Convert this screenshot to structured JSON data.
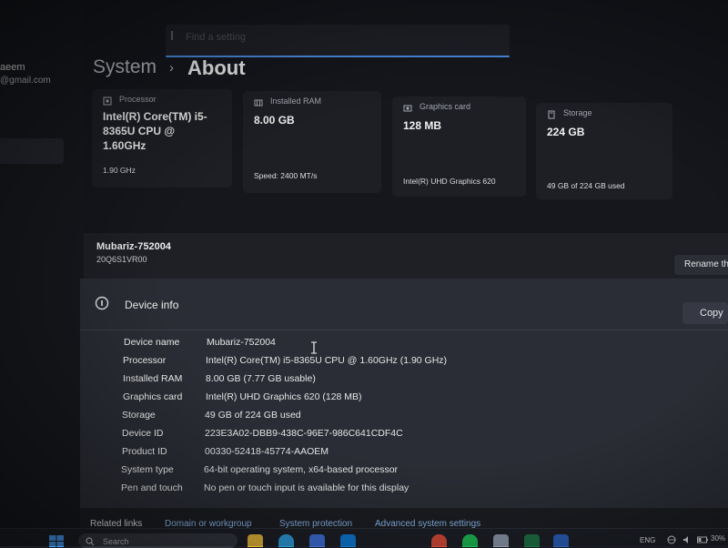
{
  "sidebar": {
    "user_name": "aeem",
    "user_email": "@gmail.com"
  },
  "search": {
    "placeholder": "Find a setting"
  },
  "breadcrumb": {
    "parent": "System",
    "separator": "›",
    "current": "About"
  },
  "specs_cards": [
    {
      "icon": "processor-icon",
      "title": "Processor",
      "value": "Intel(R) Core(TM) i5-8365U CPU @ 1.60GHz",
      "sub": "1.90 GHz"
    },
    {
      "icon": "ram-icon",
      "title": "Installed RAM",
      "value": "8.00 GB",
      "sub": "Speed: 2400 MT/s"
    },
    {
      "icon": "graphics-card-icon",
      "title": "Graphics card",
      "value": "128 MB",
      "sub": "Intel(R) UHD Graphics 620"
    },
    {
      "icon": "storage-icon",
      "title": "Storage",
      "value": "224 GB",
      "sub": "49 GB of 224 GB used"
    }
  ],
  "device": {
    "name": "Mubariz-752004",
    "model": "20Q6S1VR00",
    "rename_label": "Rename this PC"
  },
  "device_info": {
    "title": "Device info",
    "copy_label": "Copy",
    "rows": [
      {
        "label": "Device name",
        "value": "Mubariz-752004"
      },
      {
        "label": "Processor",
        "value": "Intel(R) Core(TM) i5-8365U CPU @ 1.60GHz (1.90 GHz)"
      },
      {
        "label": "Installed RAM",
        "value": "8.00 GB (7.77 GB usable)"
      },
      {
        "label": "Graphics card",
        "value": "Intel(R) UHD Graphics 620 (128 MB)"
      },
      {
        "label": "Storage",
        "value": "49 GB of 224 GB used"
      },
      {
        "label": "Device ID",
        "value": "223E3A02-DBB9-438C-96E7-986C641CDF4C"
      },
      {
        "label": "Product ID",
        "value": "00330-52418-45774-AAOEM"
      },
      {
        "label": "System type",
        "value": "64-bit operating system, x64-based processor"
      },
      {
        "label": "Pen and touch",
        "value": "No pen or touch input is available for this display"
      }
    ]
  },
  "related_links": {
    "label": "Related links",
    "links": [
      "Domain or workgroup",
      "System protection",
      "Advanced system settings"
    ]
  },
  "taskbar": {
    "search_text": "Search",
    "apps": [
      "file-explorer-icon",
      "edge-icon",
      "store-icon",
      "mail-icon",
      "chrome-icon",
      "spotify-icon",
      "settings-icon",
      "excel-icon",
      "word-icon"
    ],
    "language": "ENG",
    "battery_level": "30%"
  },
  "colors": {
    "accent": "#4c8fe6",
    "window_bg": "#15171d",
    "card_bg": "#1d1f25",
    "panel_bg": "#2a2d35"
  }
}
